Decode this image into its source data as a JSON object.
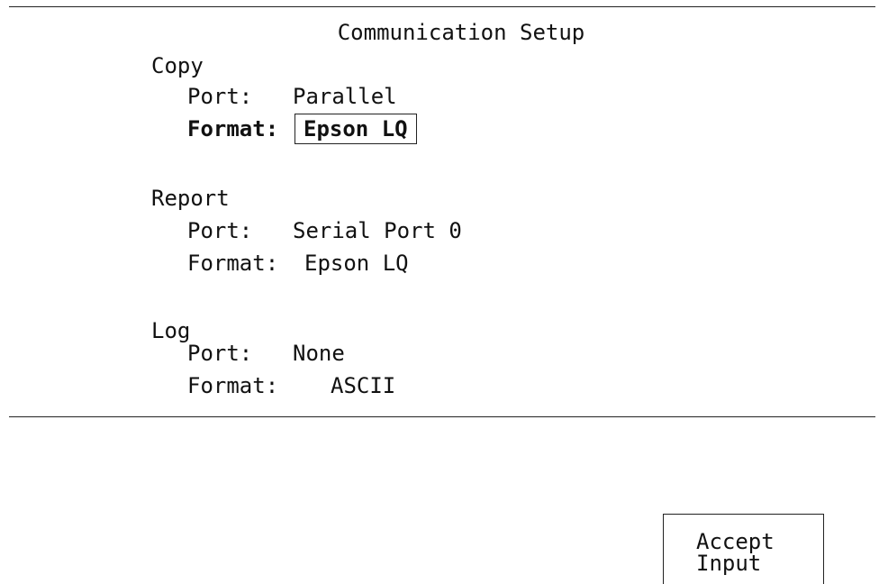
{
  "screen": {
    "title": "Communication Setup"
  },
  "sections": {
    "copy": {
      "heading": "Copy",
      "port_label": "Port:",
      "port_value": "Parallel",
      "format_label": "Format:",
      "format_value": "Epson LQ"
    },
    "report": {
      "heading": "Report",
      "port_label": "Port:",
      "port_value": "Serial Port 0",
      "format_label": "Format:",
      "format_value": "Epson LQ"
    },
    "log": {
      "heading": "Log",
      "port_label": "Port:",
      "port_value": "None",
      "format_label": "Format:",
      "format_value": "ASCII"
    }
  },
  "accept_button": {
    "line1": "Accept",
    "line2": "Input"
  }
}
